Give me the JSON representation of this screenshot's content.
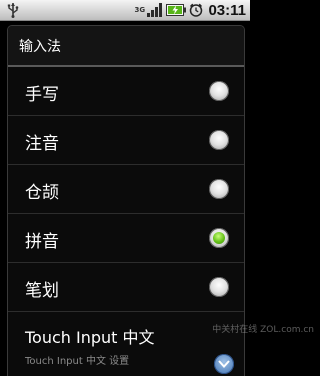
{
  "status_bar": {
    "network_label": "3G",
    "time": "03:11",
    "icons": [
      "usb-icon",
      "signal-icon",
      "battery-icon",
      "alarm-icon"
    ]
  },
  "dialog": {
    "title": "输入法",
    "items": [
      {
        "label": "手写",
        "selected": false
      },
      {
        "label": "注音",
        "selected": false
      },
      {
        "label": "仓颉",
        "selected": false
      },
      {
        "label": "拼音",
        "selected": true
      },
      {
        "label": "笔划",
        "selected": false
      }
    ],
    "last_item": {
      "label": "Touch Input 中文",
      "subtitle": "Touch Input 中文 设置"
    }
  },
  "watermark": "中关村在线 ZOL.com.cn",
  "colors": {
    "selected_radio": "#66c21a",
    "scroll_button": "#3d6fb0"
  }
}
